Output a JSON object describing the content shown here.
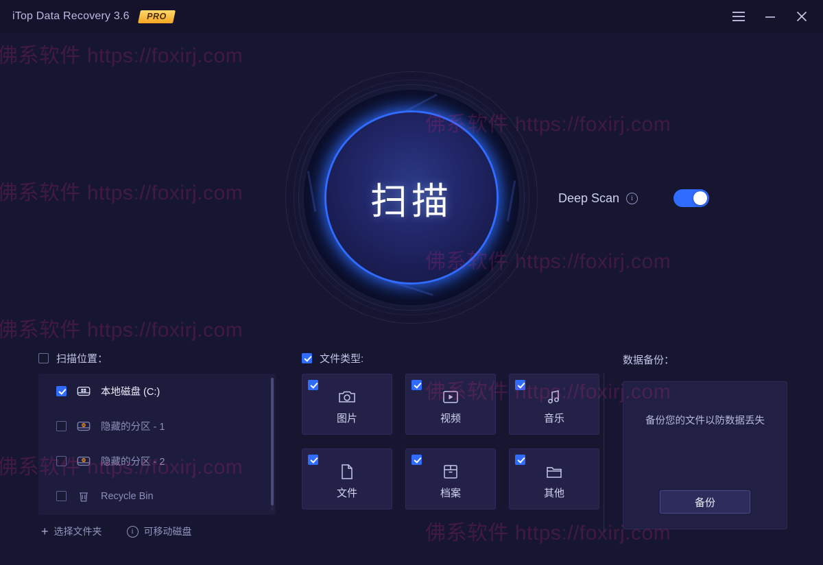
{
  "window": {
    "title": "iTop Data Recovery 3.6",
    "badge": "PRO",
    "controls": {
      "menu": "menu-icon",
      "minimize": "minimize-icon",
      "close": "close-icon"
    }
  },
  "watermark": {
    "text": "佛系软件 https://foxirj.com",
    "color": "#d62984"
  },
  "scan": {
    "button_label": "扫描",
    "deep_scan_label": "Deep Scan",
    "deep_scan_info": "i",
    "deep_scan_enabled": true,
    "accent_color": "#2f6cff"
  },
  "locations": {
    "header_label": "扫描位置：",
    "header_checked": false,
    "items": [
      {
        "label": "本地磁盘 (C:)",
        "checked": true,
        "icon": "hard-disk-windows-icon",
        "active": true
      },
      {
        "label": "隐藏的分区 - 1",
        "checked": false,
        "icon": "hidden-partition-icon",
        "active": false
      },
      {
        "label": "隐藏的分区 - 2",
        "checked": false,
        "icon": "hidden-partition-icon",
        "active": false
      },
      {
        "label": "Recycle Bin",
        "checked": false,
        "icon": "trash-icon",
        "active": false
      }
    ],
    "footer": {
      "select_folder": "选择文件夹",
      "select_folder_icon": "plus-icon",
      "removable_disk": "可移动磁盘",
      "removable_disk_icon": "info-icon"
    }
  },
  "filetypes": {
    "header_label": "文件类型:",
    "header_checked": true,
    "tiles": [
      {
        "label": "图片",
        "icon": "camera-icon",
        "checked": true
      },
      {
        "label": "视频",
        "icon": "video-play-icon",
        "checked": true
      },
      {
        "label": "音乐",
        "icon": "music-note-icon",
        "checked": true
      },
      {
        "label": "文件",
        "icon": "document-icon",
        "checked": true
      },
      {
        "label": "档案",
        "icon": "archive-box-icon",
        "checked": true
      },
      {
        "label": "其他",
        "icon": "folder-icon",
        "checked": true
      }
    ]
  },
  "backup": {
    "header_label": "数据备份：",
    "description": "备份您的文件以防数据丢失",
    "button_label": "备份"
  }
}
